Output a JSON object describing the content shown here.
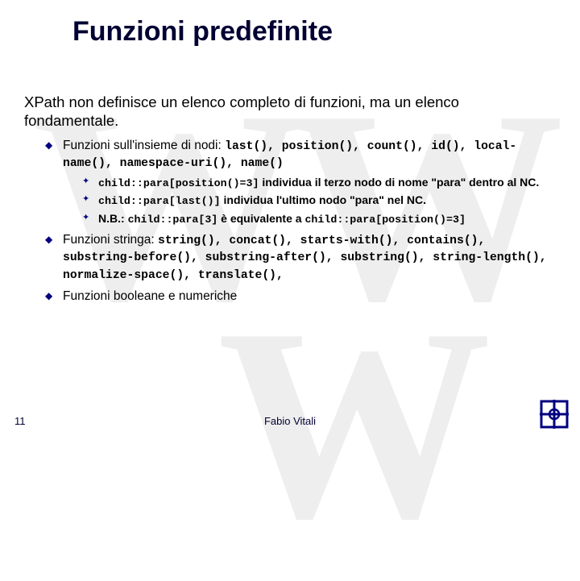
{
  "watermark": {
    "top": "WW",
    "bottom": "W"
  },
  "title": "Funzioni predefinite",
  "intro": "XPath non definisce un elenco completo di funzioni, ma un elenco fondamentale.",
  "bullets": [
    {
      "pre": "Funzioni sull'insieme di nodi: ",
      "code": "last(), position(), count(), id(), local-name(), namespace-uri(), name()",
      "post": "",
      "sub": [
        {
          "code1": "child::para[position()=3]",
          "text1": " individua il terzo nodo di nome \"para\" dentro al NC."
        },
        {
          "code1": "child::para[last()]",
          "text1": " individua l'ultimo nodo \"para\" nel NC."
        },
        {
          "textPre": "N.B.: ",
          "code1": "child::para[3]",
          "text1": " è equivalente a ",
          "code2": "child::para[position()=3]"
        }
      ]
    },
    {
      "pre": "Funzioni stringa: ",
      "code": "string(), concat(), starts-with(), contains(), substring-before(), substring-after(), substring(), string-length(), normalize-space(), translate(),",
      "post": ""
    },
    {
      "pre": "Funzioni booleane e numeriche",
      "code": "",
      "post": ""
    }
  ],
  "footer": {
    "page": "11",
    "author": "Fabio Vitali"
  }
}
